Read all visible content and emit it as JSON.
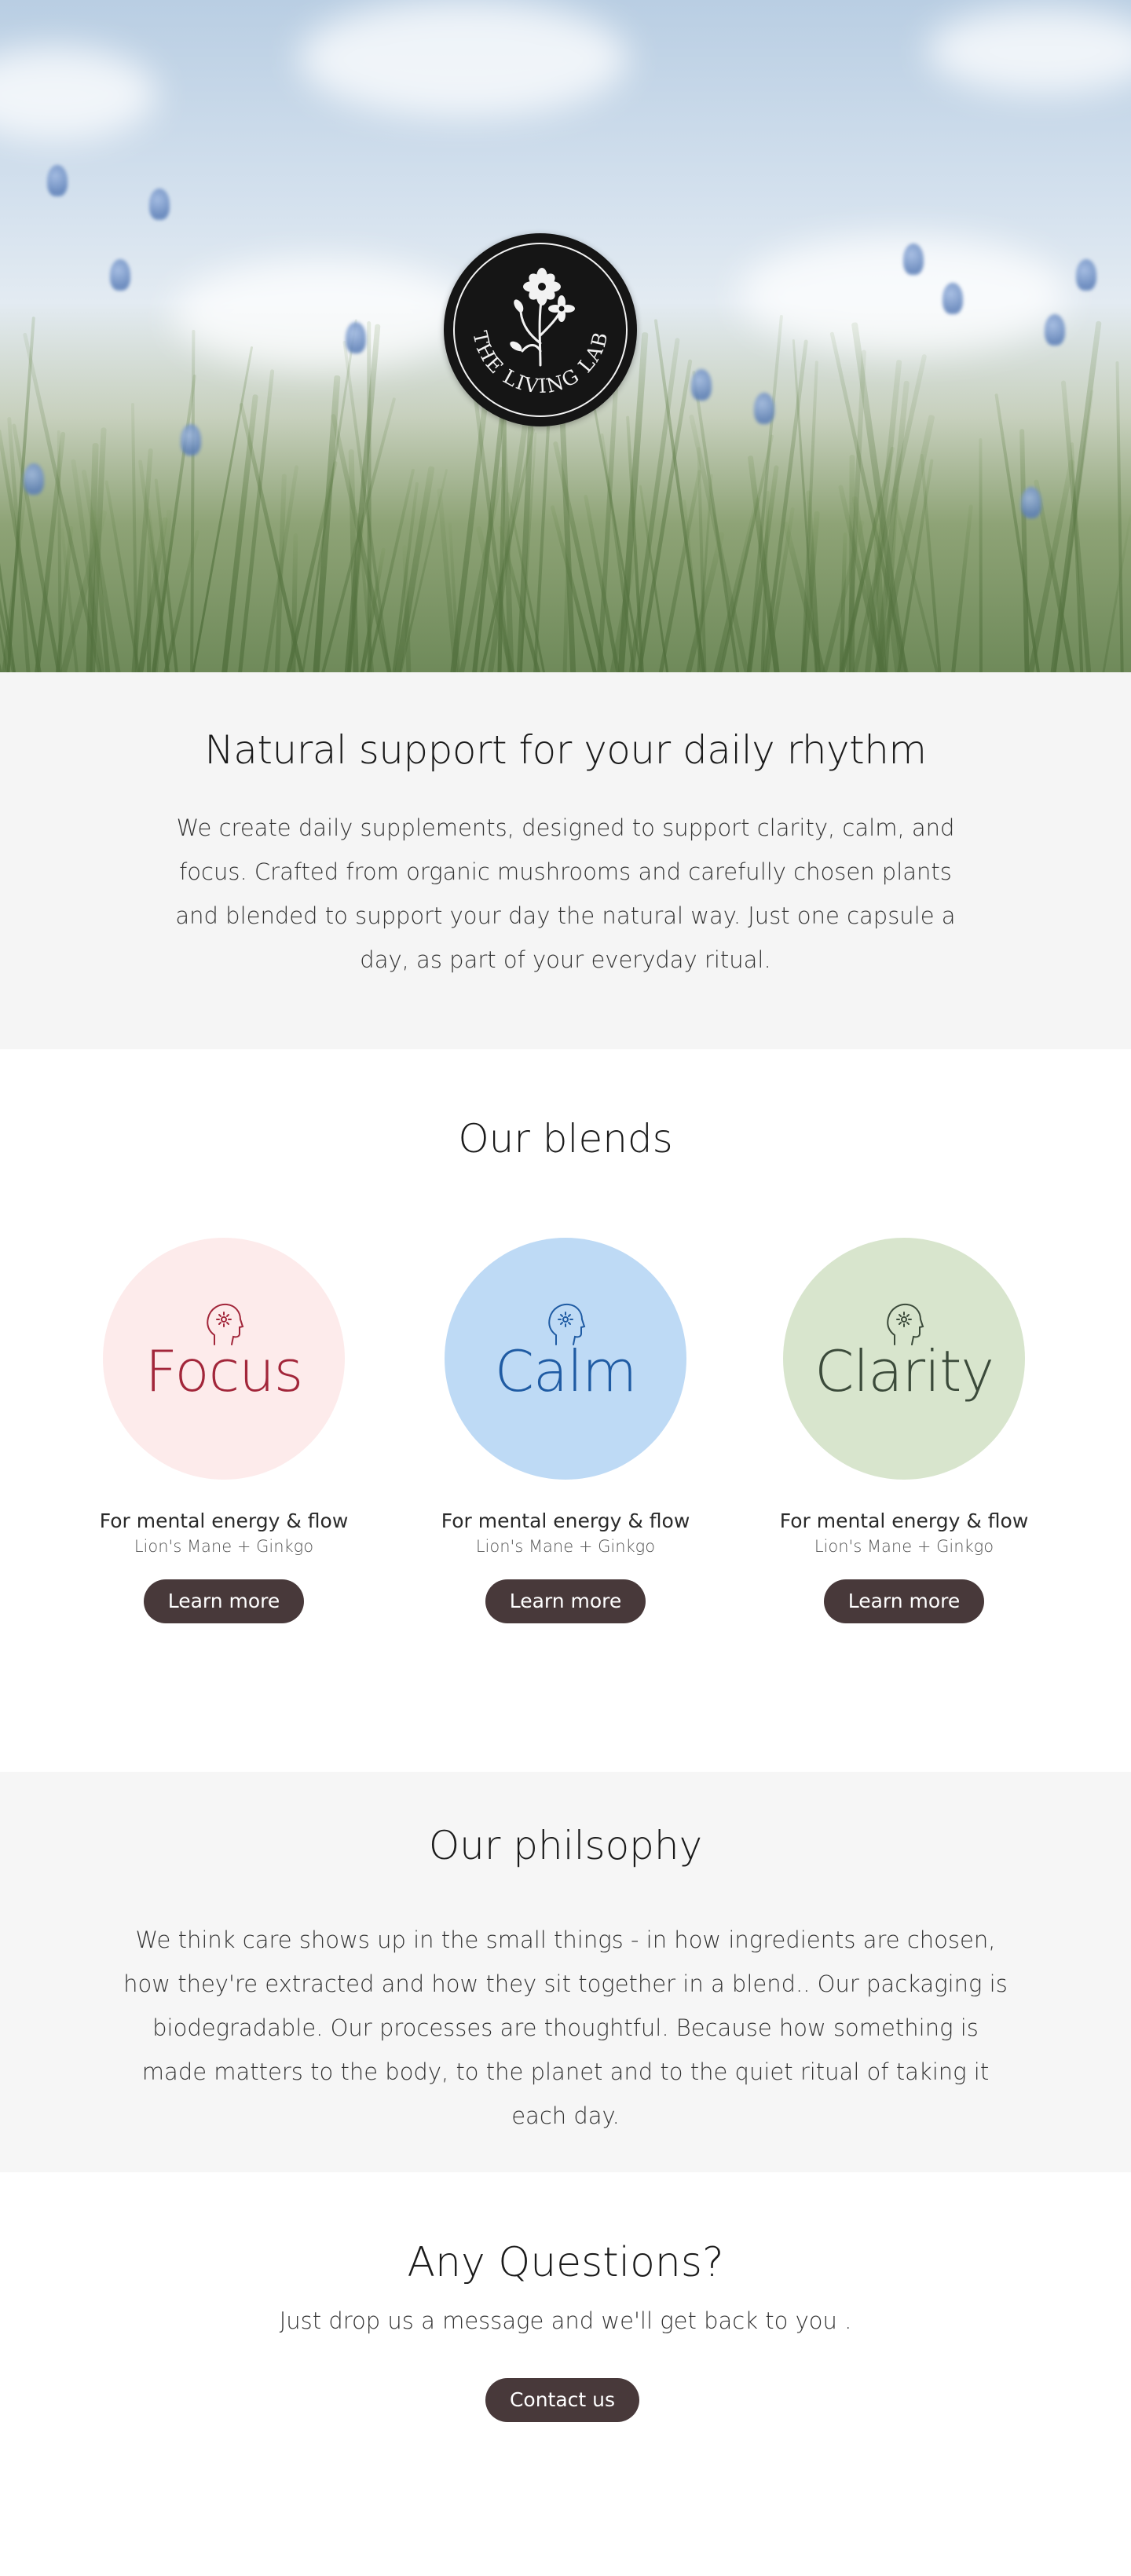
{
  "hero": {
    "logo_text": "THE LIVING LAB"
  },
  "intro": {
    "heading": "Natural support for your daily rhythm",
    "body": "We create daily supplements, designed to support clarity, calm, and focus. Crafted from organic mushrooms and carefully chosen plants and blended to support your day the natural way. Just one capsule a day, as part of your everyday ritual."
  },
  "blends": {
    "heading": "Our blends",
    "items": [
      {
        "name": "Focus",
        "tagline": "For mental energy & flow",
        "ingredients": "Lion's Mane + Ginkgo",
        "button": "Learn more",
        "circle_color": "#fdebeb",
        "text_color": "#a2263a",
        "icon": "head-sparkle-icon"
      },
      {
        "name": "Calm",
        "tagline": "For mental energy & flow",
        "ingredients": "Lion's Mane + Ginkgo",
        "button": "Learn more",
        "circle_color": "#bedaf5",
        "text_color": "#1f5ba3",
        "icon": "head-sparkle-icon"
      },
      {
        "name": "Clarity",
        "tagline": "For mental energy & flow",
        "ingredients": "Lion's Mane + Ginkgo",
        "button": "Learn more",
        "circle_color": "#d8e5cd",
        "text_color": "#3b4a3a",
        "icon": "head-sparkle-icon"
      }
    ]
  },
  "philosophy": {
    "heading": "Our philsophy",
    "body": "We think care shows up in the small things - in how ingredients are chosen, how they're extracted and how they sit together in a blend.. Our packaging is biodegradable. Our processes are thoughtful. Because how something is made matters to the body, to the planet and to the quiet ritual of taking it each day."
  },
  "questions": {
    "heading": "Any Questions?",
    "body": "Just drop us a message and we'll get back to you .",
    "button": "Contact us"
  },
  "colors": {
    "button_bg": "#48393a",
    "section_gray": "#f5f5f5"
  }
}
